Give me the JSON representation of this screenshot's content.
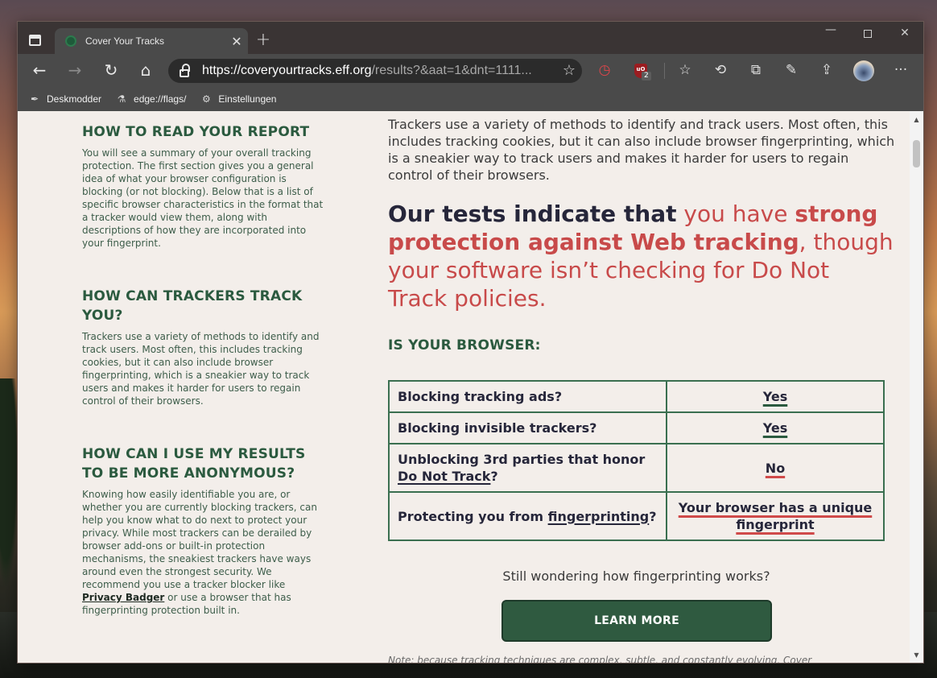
{
  "browser": {
    "tab_title": "Cover Your Tracks",
    "url_host": "https://coveryourtracks.eff.org",
    "url_rest": "/results?&aat=1&dnt=1111...",
    "ublock_badge": "2",
    "bookmarks": [
      {
        "label": "Deskmodder",
        "icon": "pen-icon"
      },
      {
        "label": "edge://flags/",
        "icon": "flask-icon"
      },
      {
        "label": "Einstellungen",
        "icon": "gear-icon"
      }
    ]
  },
  "sidebar": {
    "sections": [
      {
        "heading": "HOW TO READ YOUR REPORT",
        "body": "You will see a summary of your overall tracking protection. The first section gives you a general idea of what your browser configuration is blocking (or not blocking). Below that is a list of specific browser characteristics in the format that a tracker would view them, along with descriptions of how they are incorporated into your fingerprint."
      },
      {
        "heading": "HOW CAN TRACKERS TRACK YOU?",
        "body": "Trackers use a variety of methods to identify and track users. Most often, this includes tracking cookies, but it can also include browser fingerprinting, which is a sneakier way to track users and makes it harder for users to regain control of their browsers."
      },
      {
        "heading": "HOW CAN I USE MY RESULTS TO BE MORE ANONYMOUS?",
        "body_before_link": "Knowing how easily identifiable you are, or whether you are currently blocking trackers, can help you know what to do next to protect your privacy. While most trackers can be derailed by browser add-ons or built-in protection mechanisms, the sneakiest trackers have ways around even the strongest security. We recommend you use a tracker blocker like ",
        "link": "Privacy Badger",
        "body_after_link": " or use a browser that has fingerprinting protection built in."
      }
    ]
  },
  "main": {
    "intro": "Trackers use a variety of methods to identify and track users. Most often, this includes tracking cookies, but it can also include browser fingerprinting, which is a sneakier way to track users and makes it harder for users to regain control of their browsers.",
    "verdict_lead": "Our tests indicate that",
    "verdict_mid": " you have ",
    "verdict_strong": "strong protection against Web tracking",
    "verdict_tail": ", though your software isn’t checking for Do Not Track policies.",
    "is_your_browser": "IS YOUR BROWSER:",
    "results": [
      {
        "question": "Blocking tracking ads?",
        "answer": "Yes"
      },
      {
        "question": "Blocking invisible trackers?",
        "answer": "Yes"
      },
      {
        "question_pre": "Unblocking 3rd parties that honor ",
        "question_link": "Do Not Track",
        "question_post": "?",
        "answer": "No"
      },
      {
        "question_pre": "Protecting you from ",
        "question_link": "fingerprinting",
        "question_post": "?",
        "answer": "Your browser has a unique fingerprint"
      }
    ],
    "wonder": "Still wondering how fingerprinting works?",
    "learn_more": "LEARN MORE",
    "note": "Note: because tracking techniques are complex, subtle, and constantly evolving, Cover"
  }
}
